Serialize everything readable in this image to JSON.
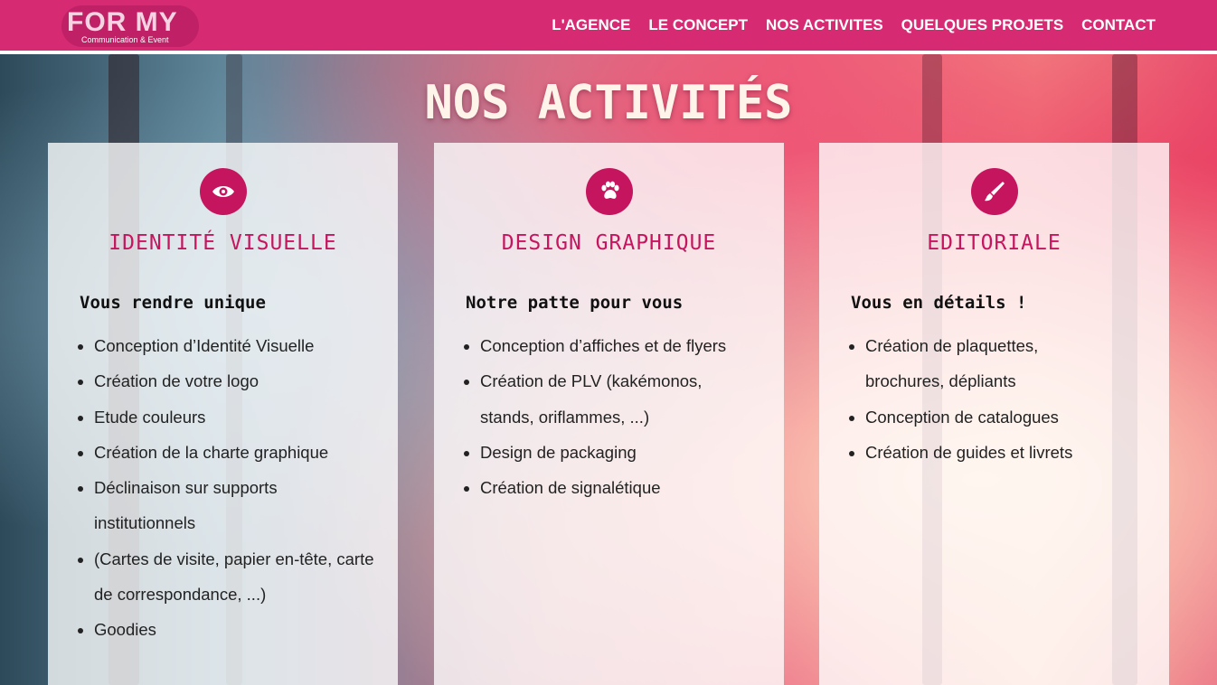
{
  "header": {
    "logo": {
      "main": "FOR MY",
      "sub": "Communication & Event"
    },
    "nav": [
      "L'AGENCE",
      "LE CONCEPT",
      "NOS ACTIVITES",
      "QUELQUES PROJETS",
      "CONTACT"
    ]
  },
  "page_title": "NOS ACTIVITÉS",
  "cards": [
    {
      "icon": "eye-icon",
      "title": "IDENTITÉ VISUELLE",
      "subtitle": "Vous rendre unique",
      "items": [
        "Conception d’Identité Visuelle",
        "Création de votre logo",
        "Etude couleurs",
        "Création de la charte graphique",
        "Déclinaison sur supports institutionnels",
        "(Cartes de visite, papier en-tête, carte de correspondance, ...)",
        "Goodies"
      ]
    },
    {
      "icon": "paw-icon",
      "title": "DESIGN GRAPHIQUE",
      "subtitle": "Notre patte pour vous",
      "items": [
        "Conception d’affiches et de flyers",
        "Création de PLV (kakémonos, stands, oriflammes, ...)",
        "Design de packaging",
        "Création de signalétique"
      ]
    },
    {
      "icon": "paintbrush-icon",
      "title": "EDITORIALE",
      "subtitle": "Vous en détails !",
      "items": [
        "Création de plaquettes, brochures, dépliants",
        "Conception de catalogues",
        "Création de guides et livrets"
      ]
    }
  ],
  "colors": {
    "brand": "#d62b73",
    "accent": "#c5155e"
  }
}
